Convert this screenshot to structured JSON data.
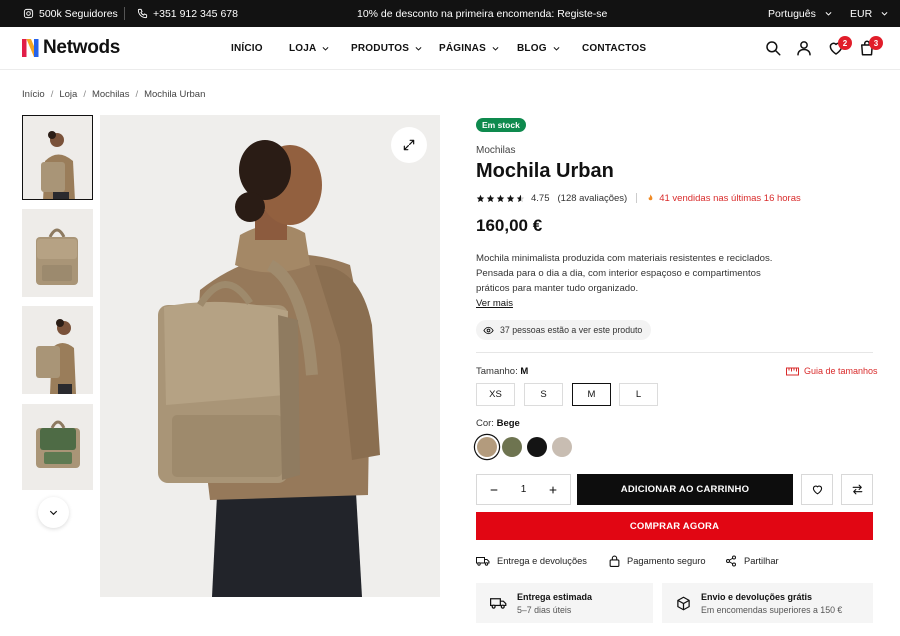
{
  "topbar": {
    "followers": "500k Seguidores",
    "phone": "+351 912 345 678",
    "promo": "10% de desconto na primeira encomenda: Registe-se",
    "language": "Português",
    "currency": "EUR"
  },
  "header": {
    "logo": "Netwods",
    "nav": [
      "INÍCIO",
      "LOJA",
      "PRODUTOS",
      "PÁGINAS",
      "BLOG",
      "CONTACTOS"
    ],
    "wishlist_count": "2",
    "cart_count": "3"
  },
  "breadcrumb": [
    "Início",
    "Loja",
    "Mochilas",
    "Mochila Urban"
  ],
  "product": {
    "stock": "Em stock",
    "category": "Mochilas",
    "title": "Mochila Urban",
    "rating": "4.75",
    "reviews": "(128 avaliações)",
    "sold": "41 vendidas nas últimas 16 horas",
    "price": "160,00 €",
    "description": "Mochila minimalista produzida com materiais resistentes e reciclados. Pensada para o dia a dia, com interior espaçoso e compartimentos práticos para manter tudo organizado.",
    "more": "Ver mais",
    "viewers": "37 pessoas estão a ver este produto",
    "size_label": "Tamanho:",
    "size_selected": "M",
    "size_guide": "Guia de tamanhos",
    "sizes": [
      "XS",
      "S",
      "M",
      "L"
    ],
    "color_label": "Cor:",
    "color_selected": "Bege",
    "colors": [
      "#b39b7d",
      "#6e7450",
      "#141414",
      "#c8bdb2"
    ],
    "quantity": "1",
    "add_to_cart": "ADICIONAR AO CARRINHO",
    "buy_now": "COMPRAR AGORA"
  },
  "links": {
    "delivery": "Entrega e devoluções",
    "payment": "Pagamento seguro",
    "share": "Partilhar"
  },
  "info": {
    "delivery_title": "Entrega estimada",
    "delivery_sub": "5–7 dias úteis",
    "shipping_title": "Envio e devoluções grátis",
    "shipping_sub": "Em encomendas superiores a 150 €"
  },
  "colors": {
    "accent_red": "#e10613",
    "stock_green": "#0e8a4e",
    "dark": "#121212"
  }
}
